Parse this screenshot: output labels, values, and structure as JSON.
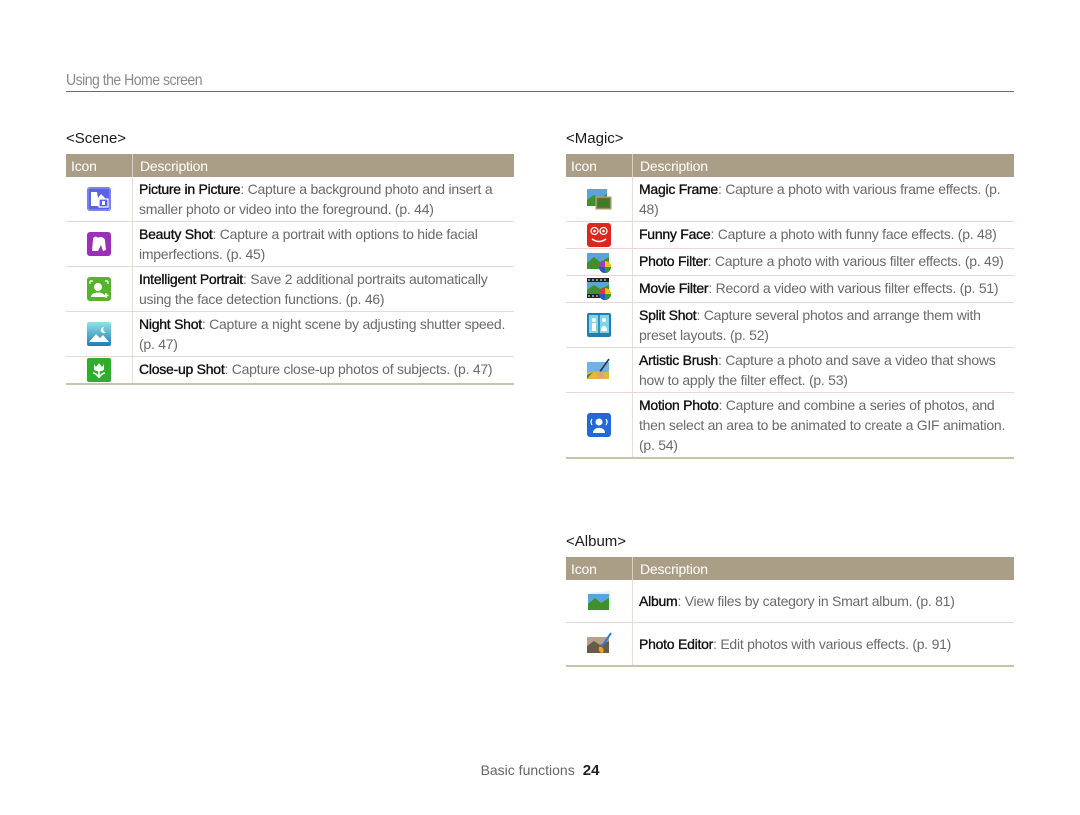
{
  "header": {
    "title": "Using the Home screen"
  },
  "table_headers": {
    "icon": "Icon",
    "description": "Description"
  },
  "scene": {
    "title": "<Scene>",
    "rows": [
      {
        "icon": "picture-in-picture-icon",
        "name": "Picture in Picture",
        "text": ": Capture a background photo and insert a smaller photo or video into the foreground. (p. 44)"
      },
      {
        "icon": "beauty-shot-icon",
        "name": "Beauty Shot",
        "text": ": Capture a portrait with options to hide facial imperfections. (p. 45)"
      },
      {
        "icon": "intelligent-portrait-icon",
        "name": "Intelligent Portrait",
        "text": ": Save 2 additional portraits automatically using the face detection functions. (p. 46)"
      },
      {
        "icon": "night-shot-icon",
        "name": "Night Shot",
        "text": ": Capture a night scene by adjusting shutter speed. (p. 47)"
      },
      {
        "icon": "close-up-shot-icon",
        "name": "Close-up Shot",
        "text": ": Capture close-up photos of subjects. (p. 47)"
      }
    ]
  },
  "magic": {
    "title": "<Magic>",
    "rows": [
      {
        "icon": "magic-frame-icon",
        "name": "Magic Frame",
        "text": ": Capture a photo with various frame effects. (p. 48)"
      },
      {
        "icon": "funny-face-icon",
        "name": "Funny Face",
        "text": ": Capture a photo with funny face effects. (p. 48)"
      },
      {
        "icon": "photo-filter-icon",
        "name": "Photo Filter",
        "text": ": Capture a photo with various filter effects. (p. 49)"
      },
      {
        "icon": "movie-filter-icon",
        "name": "Movie Filter",
        "text": ": Record a video with various filter effects. (p. 51)"
      },
      {
        "icon": "split-shot-icon",
        "name": "Split Shot",
        "text": ": Capture several photos and arrange them with preset layouts. (p. 52)"
      },
      {
        "icon": "artistic-brush-icon",
        "name": "Artistic Brush",
        "text": ": Capture a photo and save a video that shows how to apply the filter effect. (p. 53)"
      },
      {
        "icon": "motion-photo-icon",
        "name": "Motion Photo",
        "text": ": Capture and combine a series of photos, and then select an area to be animated to create a GIF animation. (p. 54)"
      }
    ]
  },
  "album": {
    "title": "<Album>",
    "rows": [
      {
        "icon": "album-icon",
        "name": "Album",
        "text": ": View files by category in Smart album. (p. 81)"
      },
      {
        "icon": "photo-editor-icon",
        "name": "Photo Editor",
        "text": ": Edit photos with various effects. (p. 91)"
      }
    ]
  },
  "footer": {
    "section": "Basic functions",
    "page": "24"
  }
}
